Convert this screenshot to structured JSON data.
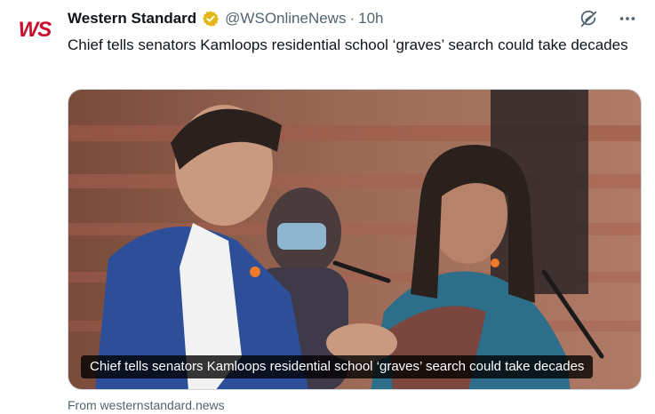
{
  "tweet": {
    "avatar_text": "WS",
    "display_name": "Western Standard",
    "handle": "@WSOnlineNews",
    "separator": "·",
    "time": "10h",
    "text": "Chief tells senators Kamloops residential school ‘graves’ search could take decades"
  },
  "card": {
    "caption": "Chief tells senators Kamloops residential school ‘graves’ search could take decades",
    "source": "From westernstandard.news"
  },
  "icons": {
    "verified": "verified-badge-icon",
    "grok": "grok-icon",
    "more": "more-options-icon"
  },
  "colors": {
    "brand_red": "#c8102e",
    "verified_gold": "#e2b719",
    "secondary_text": "#536471"
  }
}
